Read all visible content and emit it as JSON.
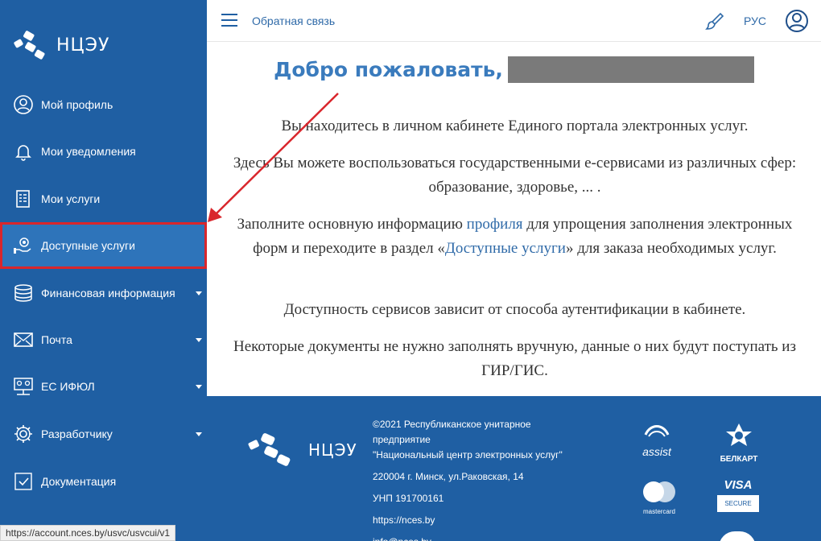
{
  "brand": {
    "name": "НЦЭУ"
  },
  "sidebar": {
    "items": [
      {
        "label": "Мой профиль",
        "icon": "user-circle-icon"
      },
      {
        "label": "Мои уведомления",
        "icon": "bell-icon"
      },
      {
        "label": "Мои услуги",
        "icon": "document-list-icon"
      },
      {
        "label": "Доступные услуги",
        "icon": "hand-gear-icon"
      },
      {
        "label": "Финансовая информация",
        "icon": "coins-icon"
      },
      {
        "label": "Почта",
        "icon": "envelope-icon"
      },
      {
        "label": "ЕС ИФЮЛ",
        "icon": "network-icon"
      },
      {
        "label": "Разработчику",
        "icon": "gear-icon"
      },
      {
        "label": "Документация",
        "icon": "checkbox-icon"
      }
    ]
  },
  "header": {
    "feedback": "Обратная связь",
    "lang": "РУС"
  },
  "main": {
    "welcome": "Добро пожаловать,",
    "p1": "Вы находитесь в личном кабинете Единого портала электронных услуг.",
    "p2": "Здесь Вы можете воспользоваться государственными е-сервисами из различных сфер: образование, здоровье, ... .",
    "p3_before": "Заполните основную информацию ",
    "p3_link1": "профиля",
    "p3_mid": " для упрощения заполнения электронных форм и переходите в раздел «",
    "p3_link2": "Доступные услуги",
    "p3_after": "» для заказа необходимых услуг.",
    "p4": "Доступность сервисов зависит от способа аутентификации в кабинете.",
    "p5": "Некоторые документы не нужно заполнять вручную, данные о них будут поступать из ГИР/ГИС."
  },
  "footer": {
    "org_line1": "©2021 Республиканское унитарное",
    "org_line2": "предприятие",
    "org_line3": "\"Национальный центр электронных услуг\"",
    "address": "220004 г. Минск, ул.Раковская, 14",
    "unp": "УНП 191700161",
    "site": "https://nces.by",
    "email": "info@nces.by",
    "payments": {
      "assist": "assist",
      "belkart": "БЕЛКАРТ",
      "mastercard": "mastercard",
      "visa": "VISA",
      "secure": "SECURE"
    }
  },
  "status_url": "https://account.nces.by/usvc/usvcui/v1",
  "colors": {
    "sidebar": "#1f5fa3",
    "accent": "#3a7bbd",
    "highlight": "#d9262c"
  }
}
